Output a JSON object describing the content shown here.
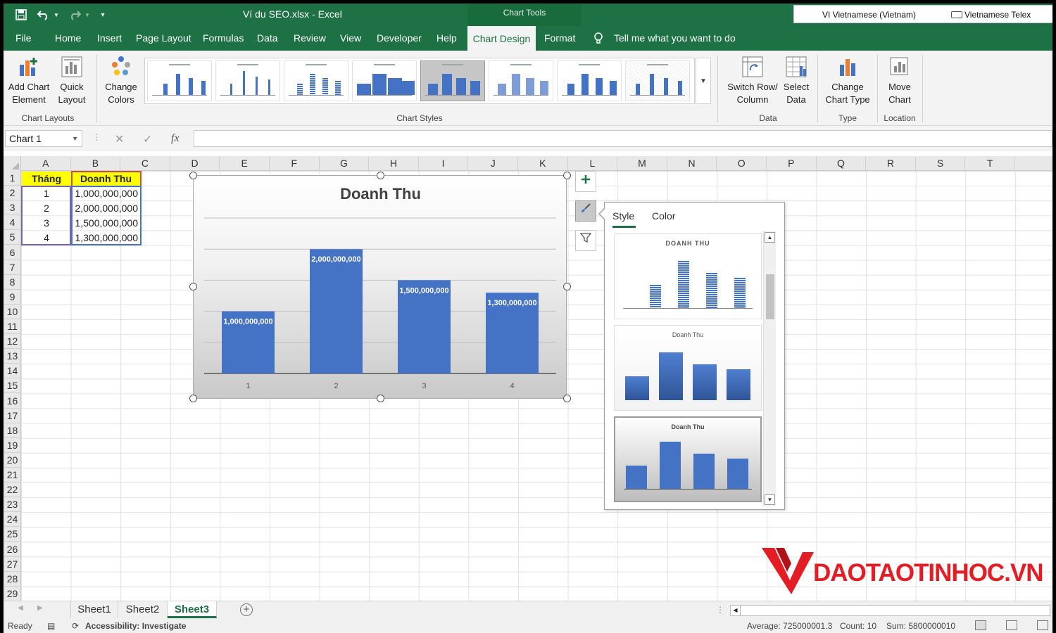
{
  "window": {
    "title": "Ví du SEO.xlsx  -  Excel",
    "context_tab_group": "Chart Tools"
  },
  "ime": {
    "language": "VI  Vietnamese (Vietnam)",
    "input_method": "Vietnamese Telex"
  },
  "tabs": [
    "File",
    "Home",
    "Insert",
    "Page Layout",
    "Formulas",
    "Data",
    "Review",
    "View",
    "Developer",
    "Help",
    "Chart Design",
    "Format"
  ],
  "active_tab": "Chart Design",
  "tell_me": "Tell me what you want to do",
  "ribbon": {
    "add_chart_element": "Add Chart\nElement",
    "quick_layout": "Quick\nLayout",
    "change_colors": "Change\nColors",
    "group_chart_layouts": "Chart Layouts",
    "group_chart_styles": "Chart Styles",
    "switch_row_column": "Switch Row/\nColumn",
    "select_data": "Select\nData",
    "group_data": "Data",
    "change_chart_type": "Change\nChart Type",
    "group_type": "Type",
    "move_chart": "Move\nChart",
    "group_location": "Location",
    "gallery_selected_index": 4
  },
  "formula_bar": {
    "name_box": "Chart 1",
    "fx": "fx",
    "value": ""
  },
  "columns": [
    "A",
    "B",
    "C",
    "D",
    "E",
    "F",
    "G",
    "H",
    "I",
    "J",
    "K",
    "L",
    "M",
    "N",
    "O",
    "P",
    "Q",
    "R",
    "S",
    "T"
  ],
  "rows": [
    "1",
    "2",
    "3",
    "4",
    "5",
    "6",
    "7",
    "8",
    "9",
    "10",
    "11",
    "12",
    "13",
    "14",
    "15",
    "16",
    "17",
    "18",
    "19",
    "20",
    "21",
    "22",
    "23",
    "24",
    "25",
    "26",
    "27",
    "28",
    "29"
  ],
  "table": {
    "headers": [
      "Tháng",
      "Doanh Thu"
    ],
    "rows": [
      [
        "1",
        "1,000,000,000"
      ],
      [
        "2",
        "2,000,000,000"
      ],
      [
        "3",
        "1,500,000,000"
      ],
      [
        "4",
        "1,300,000,000"
      ]
    ]
  },
  "chart_data": {
    "type": "bar",
    "title": "Doanh Thu",
    "categories": [
      "1",
      "2",
      "3",
      "4"
    ],
    "values": [
      1000000000,
      2000000000,
      1500000000,
      1300000000
    ],
    "data_labels": [
      "1,000,000,000",
      "2,000,000,000",
      "1,500,000,000",
      "1,300,000,000"
    ],
    "ylim": [
      0,
      2500000000
    ],
    "grid": true,
    "color": "#4472c4"
  },
  "flyout": {
    "tab_style": "Style",
    "tab_color": "Color",
    "thumb_titles": [
      "DOANH THU",
      "Doanh Thu",
      "Doanh Thu"
    ]
  },
  "sheets": [
    "Sheet1",
    "Sheet2",
    "Sheet3"
  ],
  "active_sheet": "Sheet3",
  "status": {
    "ready": "Ready",
    "accessibility": "Accessibility: Investigate",
    "average": "Average: 725000001.3",
    "count": "Count: 10",
    "sum": "Sum: 5800000010"
  },
  "watermark": "DAOTAOTINHOC.VN",
  "colors": {
    "excel_green": "#1e7145",
    "bar_blue": "#4472c4",
    "header_yellow": "#ffff00",
    "brand_red": "#e41c24"
  }
}
